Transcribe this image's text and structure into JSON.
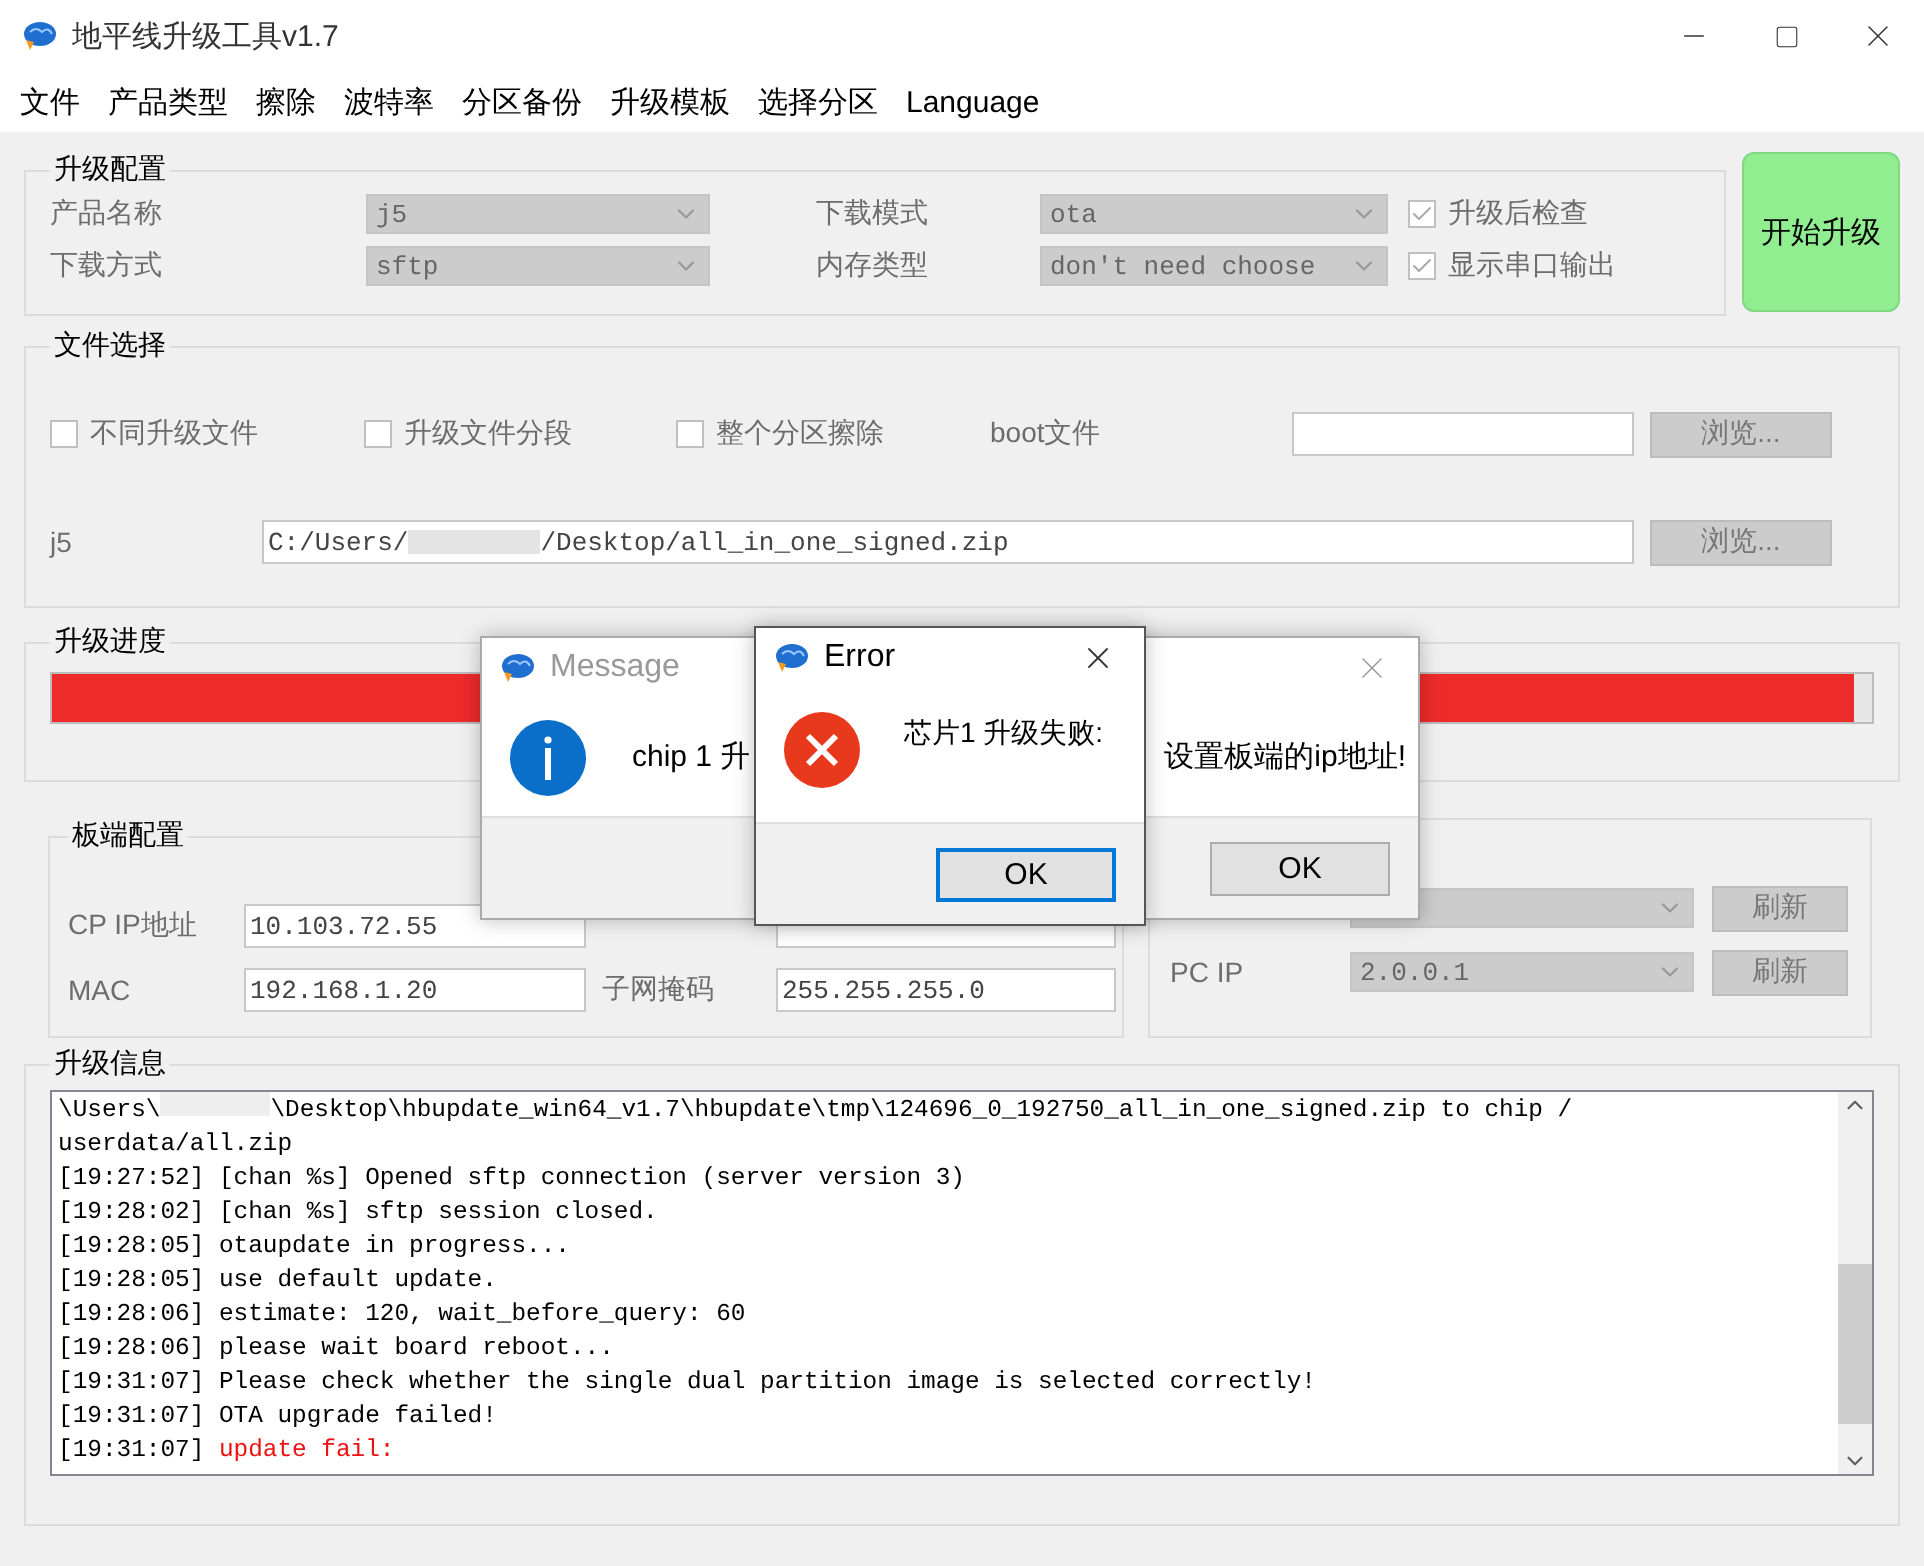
{
  "window": {
    "title": "地平线升级工具v1.7"
  },
  "menu": [
    "文件",
    "产品类型",
    "擦除",
    "波特率",
    "分区备份",
    "升级模板",
    "选择分区",
    "Language"
  ],
  "upgrade_config": {
    "title": "升级配置",
    "fields": [
      {
        "label": "产品名称",
        "value": "j5"
      },
      {
        "label": "下载模式",
        "value": "ota"
      },
      {
        "label": "下载方式",
        "value": "sftp"
      },
      {
        "label": "内存类型",
        "value": "don't need choose"
      }
    ],
    "checks": [
      {
        "label": "升级后检查",
        "checked": true
      },
      {
        "label": "显示串口输出",
        "checked": true
      }
    ]
  },
  "start_button": "开始升级",
  "file_select": {
    "title": "文件选择",
    "options": [
      {
        "label": "不同升级文件",
        "checked": false
      },
      {
        "label": "升级文件分段",
        "checked": false
      },
      {
        "label": "整个分区擦除",
        "checked": false
      }
    ],
    "boot_label": "boot文件",
    "browse_buttons": [
      "浏览...",
      "浏览..."
    ],
    "j5_label": "j5",
    "path_start": "C:/Users/",
    "path_end": "/Desktop/all_in_one_signed.zip"
  },
  "progress": {
    "title": "升级进度",
    "level": 0.99
  },
  "board_config": {
    "title": "板端配置",
    "fields": [
      {
        "label": "CP IP地址",
        "value": "10.103.72.55"
      },
      {
        "label": "MAC",
        "value": "192.168.1.20"
      },
      {
        "label": "子网掩码",
        "value": "255.255.255.0"
      }
    ],
    "pc_ip": {
      "label": "PC IP",
      "value": "2.0.0.1"
    },
    "refresh_buttons": [
      "刷新",
      "刷新"
    ]
  },
  "log": {
    "title": "升级信息",
    "lines": [
      {
        "kind": "redacted",
        "before": "\\Users\\",
        "after": "\\Desktop\\hbupdate_win64_v1.7\\hbupdate\\tmp\\124696_0_192750_all_in_one_signed.zip to chip /"
      },
      {
        "kind": "plain",
        "text": "userdata/all.zip"
      },
      {
        "kind": "info",
        "time": "[19:27:52]",
        "text": "[chan %s] Opened sftp connection (server version 3)"
      },
      {
        "kind": "info",
        "time": "[19:28:02]",
        "text": "[chan %s] sftp session closed."
      },
      {
        "kind": "info",
        "time": "[19:28:05]",
        "text": "otaupdate in progress..."
      },
      {
        "kind": "info",
        "time": "[19:28:05]",
        "text": "use default update."
      },
      {
        "kind": "info",
        "time": "[19:28:06]",
        "text": "estimate: 120, wait_before_query: 60"
      },
      {
        "kind": "info",
        "time": "[19:28:06]",
        "text": "please wait board reboot..."
      },
      {
        "kind": "info",
        "time": "[19:31:07]",
        "text": "Please check whether the single dual partition image is selected correctly!"
      },
      {
        "kind": "info",
        "time": "[19:31:07]",
        "text": "OTA upgrade failed!"
      },
      {
        "kind": "error",
        "time": "[19:31:07]",
        "text": "update fail:"
      }
    ]
  },
  "message_dialog": {
    "title": "Message",
    "text_start": "chip 1 升",
    "text_end": "设置板端的ip地址!",
    "button": "OK"
  },
  "error_dialog": {
    "title": "Error",
    "text": "芯片1 升级失败:",
    "button": "OK"
  }
}
